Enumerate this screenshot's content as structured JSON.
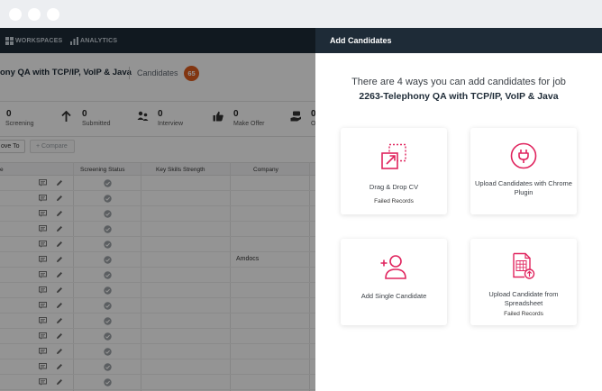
{
  "nav": {
    "workspaces": "WORKSPACES",
    "analytics": "ANALYTICS"
  },
  "job": {
    "title": "ony QA with TCP/IP, VoIP & Java",
    "candidates_label": "Candidates",
    "candidates_count": "65"
  },
  "stats": [
    {
      "value": "0",
      "label": "Screening",
      "icon": "document-icon"
    },
    {
      "value": "0",
      "label": "Submitted",
      "icon": "arrow-up-icon"
    },
    {
      "value": "0",
      "label": "Interview",
      "icon": "people-icon"
    },
    {
      "value": "0",
      "label": "Make Offer",
      "icon": "thumbs-up-icon"
    },
    {
      "value": "0",
      "label": "O",
      "icon": "hand-money-icon"
    }
  ],
  "toolbar": {
    "move_to": "ove To",
    "compare": "+ Compare"
  },
  "table": {
    "columns": [
      "e",
      "Screening Status",
      "Key Skills Strength",
      "Company"
    ],
    "rows": [
      "",
      "",
      "",
      "",
      "",
      "Amdocs",
      "",
      "",
      "",
      "",
      "",
      "",
      "",
      ""
    ]
  },
  "panel": {
    "title": "Add Candidates",
    "intro": "There are 4 ways you can add candidates for job",
    "job_line": "2263-Telephony QA with TCP/IP, VoIP & Java",
    "cards": {
      "drag_drop": {
        "title": "Drag & Drop CV",
        "sub": "Failed Records",
        "icon": "drag-drop-icon"
      },
      "chrome": {
        "title": "Upload Candidates with Chrome Plugin",
        "icon": "plug-icon"
      },
      "single": {
        "title": "Add Single Candidate",
        "icon": "add-user-icon"
      },
      "spreadsheet": {
        "title": "Upload Candidate from Spreadsheet",
        "sub": "Failed Records",
        "icon": "spreadsheet-upload-icon"
      }
    }
  },
  "colors": {
    "accent": "#e0245e",
    "nav_bg": "#1e2b37",
    "badge": "#e05d1e"
  }
}
